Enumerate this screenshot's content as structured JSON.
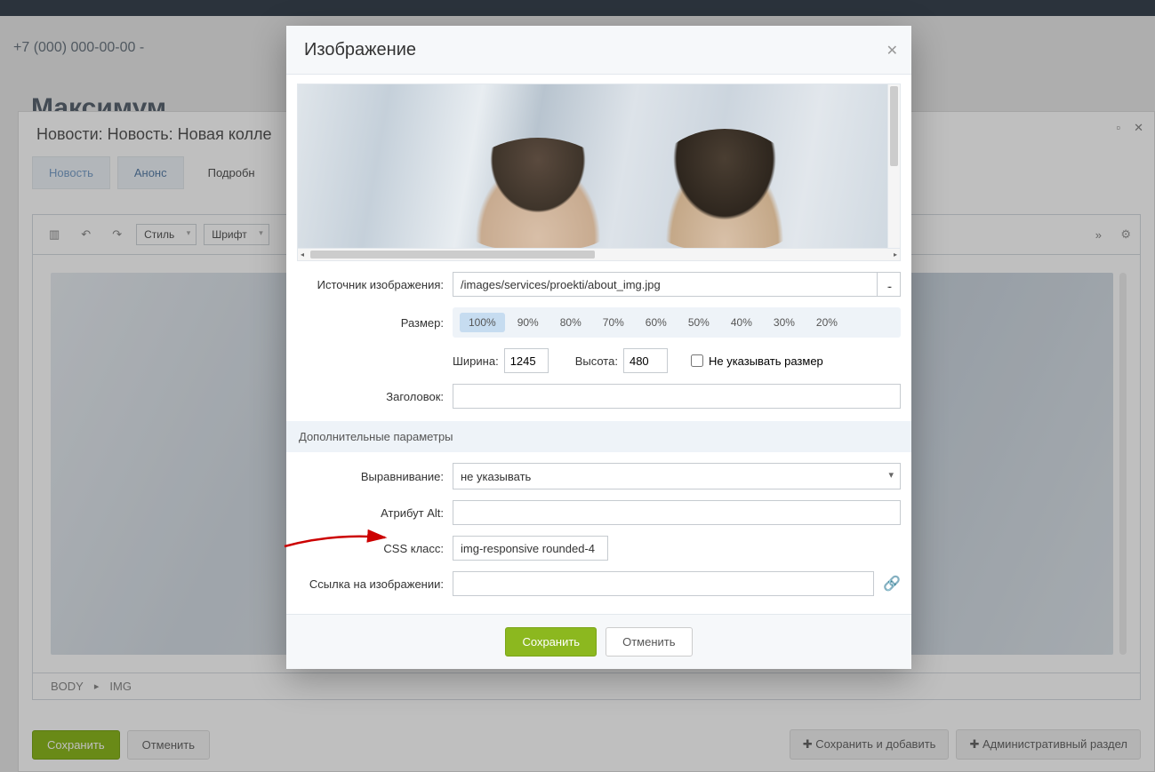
{
  "bg": {
    "phone": "+7 (000) 000-00-00 -",
    "brand": "Максимум",
    "panel_title": "Новости: Новость: Новая колле",
    "tabs": [
      "Новость",
      "Анонс",
      "Подробн"
    ],
    "toolbar": {
      "style": "Стиль",
      "font": "Шрифт"
    },
    "breadcrumb": [
      "BODY",
      "IMG"
    ],
    "save": "Сохранить",
    "cancel": "Отменить",
    "save_add": "Сохранить и добавить",
    "admin": "Административный раздел"
  },
  "modal": {
    "title": "Изображение",
    "src_label": "Источник изображения:",
    "src_value": "/images/services/proekti/about_img.jpg",
    "size_label": "Размер:",
    "sizes": [
      "100%",
      "90%",
      "80%",
      "70%",
      "60%",
      "50%",
      "40%",
      "30%",
      "20%"
    ],
    "width_label": "Ширина:",
    "width_value": "1245",
    "height_label": "Высота:",
    "height_value": "480",
    "nosize_label": "Не указывать размер",
    "title_label": "Заголовок:",
    "title_value": "",
    "extra_header": "Дополнительные параметры",
    "align_label": "Выравнивание:",
    "align_value": "не указывать",
    "alt_label": "Атрибут Alt:",
    "alt_value": "",
    "css_label": "CSS класс:",
    "css_value": "img-responsive rounded-4",
    "link_label": "Ссылка на изображении:",
    "link_value": "",
    "save": "Сохранить",
    "cancel": "Отменить"
  }
}
